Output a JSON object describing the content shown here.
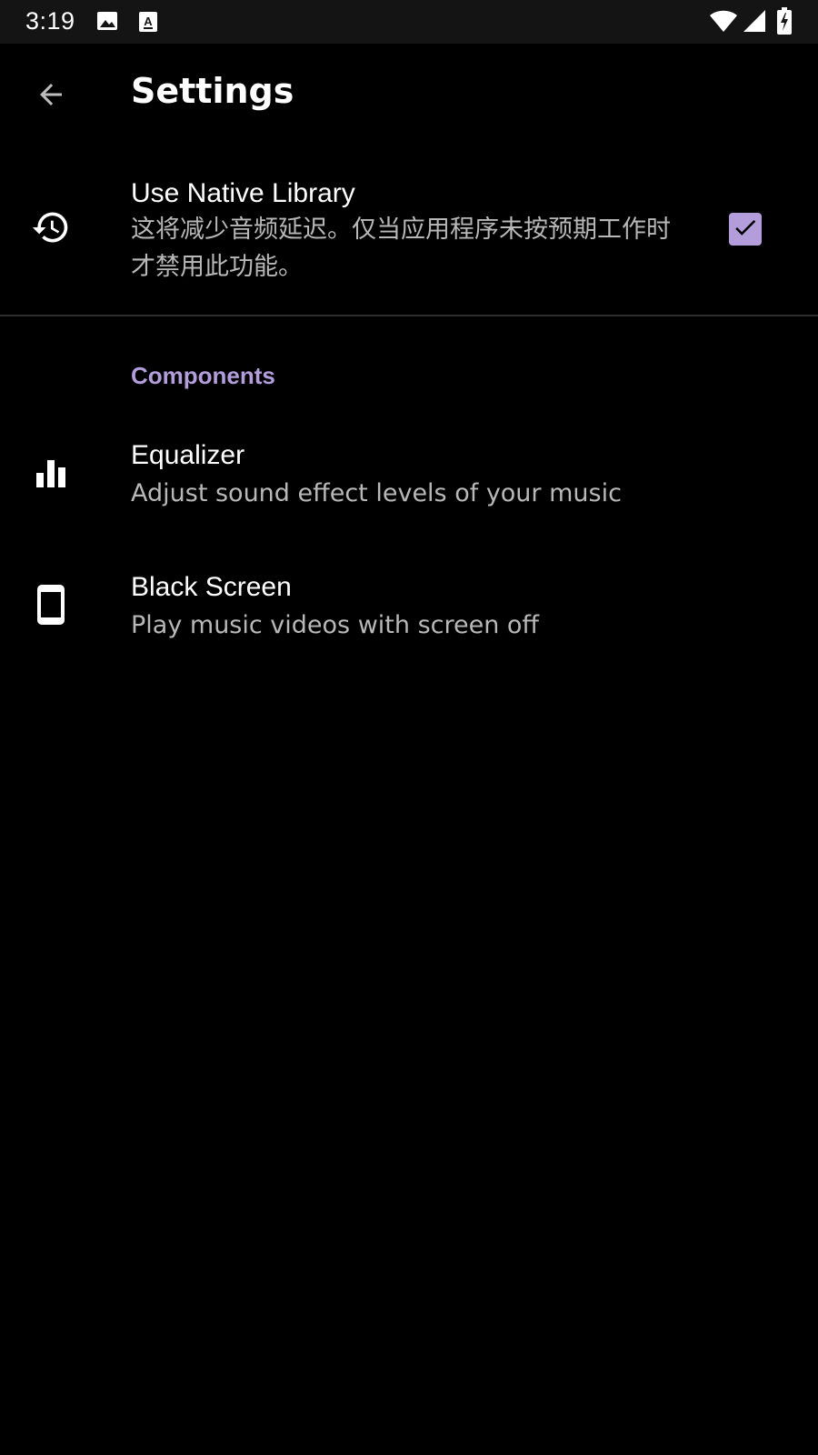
{
  "status_bar": {
    "time": "3:19",
    "icons": [
      "image-notification-icon",
      "keyboard-a-notification-icon",
      "wifi-icon",
      "cellular-signal-icon",
      "battery-charging-icon"
    ]
  },
  "toolbar": {
    "title": "Settings",
    "back_icon": "arrow-back-icon"
  },
  "preferences": {
    "native_library": {
      "icon": "history-icon",
      "title": "Use Native Library",
      "summary": "这将减少音频延迟。仅当应用程序未按预期工作时才禁用此功能。",
      "checked": true
    },
    "components_category": "Components",
    "equalizer": {
      "icon": "equalizer-icon",
      "title": "Equalizer",
      "summary": "Adjust sound effect levels of your music"
    },
    "black_screen": {
      "icon": "phone-icon",
      "title": "Black Screen",
      "summary": "Play music videos with screen off"
    }
  },
  "colors": {
    "background": "#000000",
    "status_bar": "#141414",
    "accent": "#b39ddb",
    "primary_text": "#ffffff",
    "secondary_text": "#b8b8b8",
    "divider": "#2e2e2e"
  }
}
